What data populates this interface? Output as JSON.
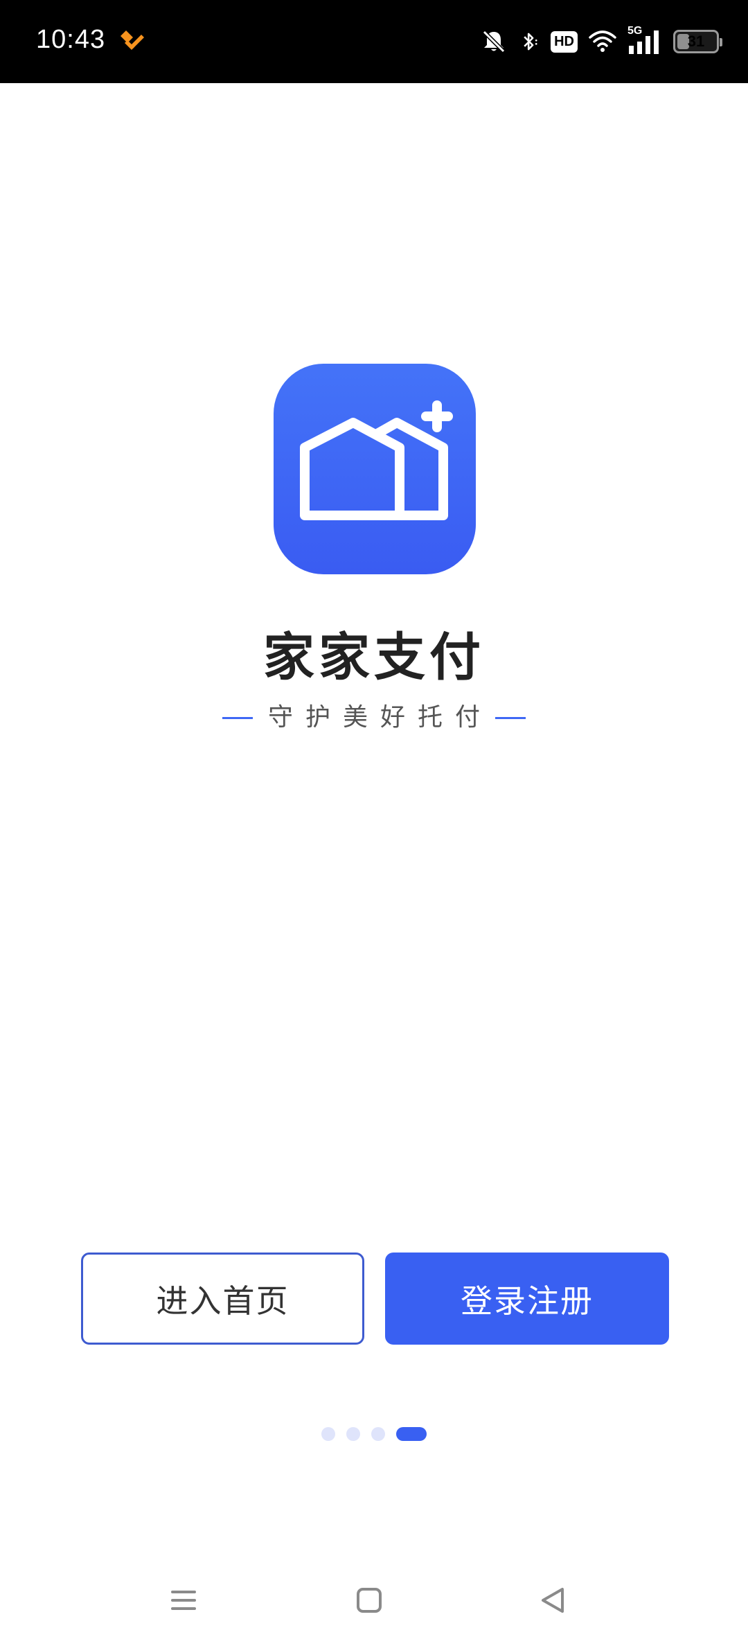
{
  "status_bar": {
    "time": "10:43",
    "hd_label": "HD",
    "network_label": "5G",
    "battery_level": "31",
    "battery_fraction": 0.31
  },
  "app": {
    "name": "家家支付",
    "slogan": "守护美好托付",
    "logo_colors": [
      "#4473f8",
      "#3a5cf2"
    ],
    "logo_icon": "house-plus-icon"
  },
  "buttons": {
    "enter_home": "进入首页",
    "login_register": "登录注册"
  },
  "pager": {
    "total": 4,
    "active": 4
  },
  "nav": {
    "menu_icon": "menu-icon",
    "home_icon": "home-square-icon",
    "back_icon": "back-triangle-icon"
  },
  "colors": {
    "accent": "#3960f2",
    "outline": "#3e5bd0",
    "dot_inactive": "#dfe4fb",
    "status_bg": "#000000",
    "app_icon": "#f7931e"
  }
}
